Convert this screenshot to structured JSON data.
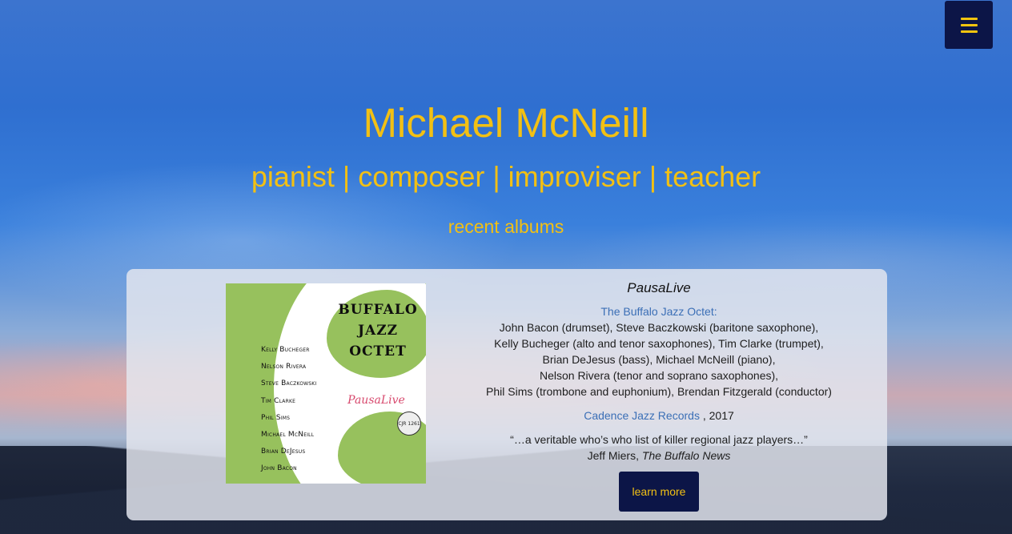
{
  "header": {
    "title": "Michael McNeill",
    "tagline": "pianist | composer | improviser | teacher",
    "section_title": "recent albums"
  },
  "menu": {
    "icon": "hamburger-menu-icon"
  },
  "album": {
    "title": "PausaLive",
    "band": "The Buffalo Jazz Octet:",
    "personnel": [
      "John Bacon (drumset), Steve Baczkowski (baritone saxophone),",
      "Kelly Bucheger (alto and tenor saxophones), Tim Clarke (trumpet),",
      "Brian DeJesus (bass), Michael McNeill (piano),",
      "Nelson Rivera (tenor and soprano saxophones),",
      "Phil Sims (trombone and euphonium), Brendan Fitzgerald (conductor)"
    ],
    "label": "Cadence Jazz Records",
    "year": ", 2017",
    "quote": "“…a veritable who’s who list of killer regional jazz players…”",
    "quote_author": "Jeff Miers,",
    "quote_source": "The Buffalo News",
    "button": "learn more",
    "cover": {
      "band_line1": "BUFFALO",
      "band_line2": "JAZZ",
      "band_line3": "OCTET",
      "album_title": "PausaLive",
      "members": [
        "Kelly Bucheger",
        "Nelson Rivera",
        "Steve Baczkowski",
        "Tim Clarke",
        "Phil Sims",
        "Michael McNeill",
        "Brian DeJesus",
        "John Bacon"
      ],
      "logo_text": "CJR 1261"
    }
  },
  "colors": {
    "accent": "#f2c014",
    "button_bg": "#0c1547",
    "link": "#3b6fb6"
  }
}
